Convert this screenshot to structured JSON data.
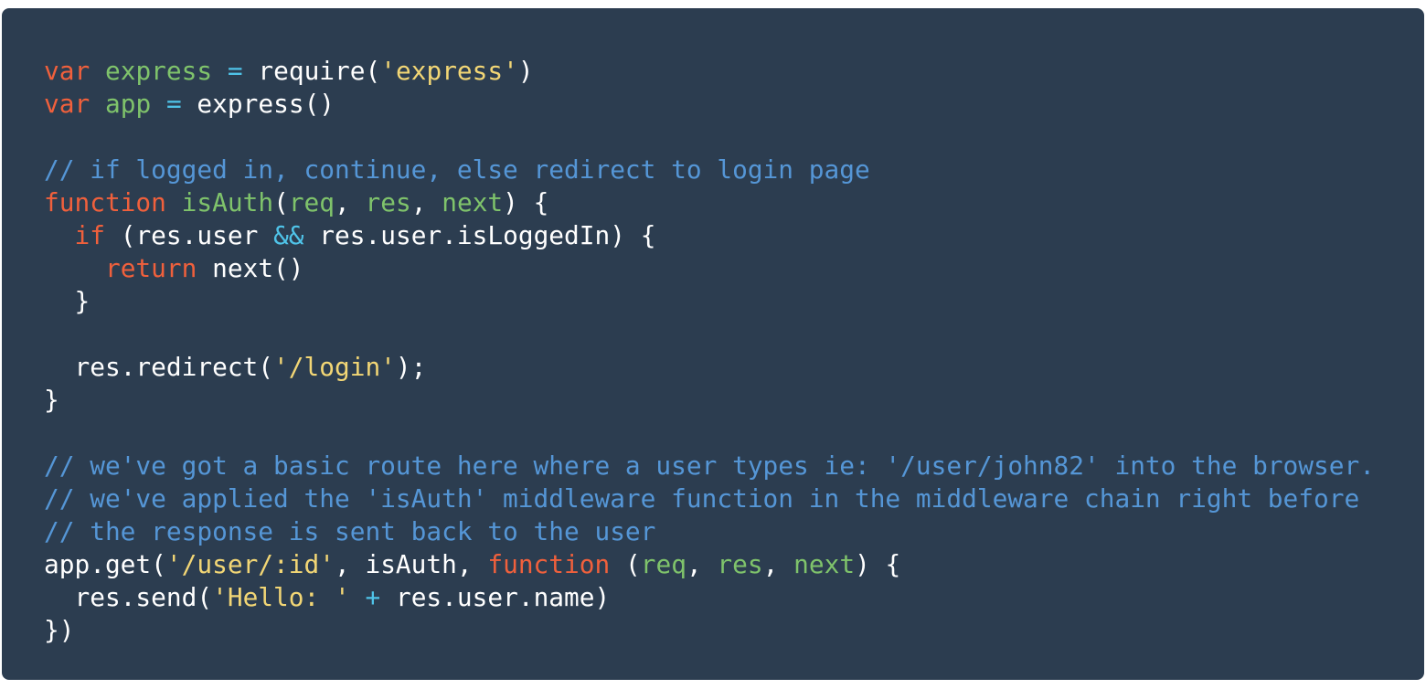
{
  "colors": {
    "background": "#2c3d50",
    "plain": "#ffffff",
    "keyword": "#f0603c",
    "identifier": "#7fc36b",
    "string": "#f2d675",
    "comment": "#5596d6",
    "operator": "#4fc3e8"
  },
  "code_lines": [
    [
      [
        "keyword",
        "var"
      ],
      [
        "plain",
        " "
      ],
      [
        "identifier",
        "express"
      ],
      [
        "plain",
        " "
      ],
      [
        "operator",
        "="
      ],
      [
        "plain",
        " require("
      ],
      [
        "string",
        "'express'"
      ],
      [
        "plain",
        ")"
      ]
    ],
    [
      [
        "keyword",
        "var"
      ],
      [
        "plain",
        " "
      ],
      [
        "identifier",
        "app"
      ],
      [
        "plain",
        " "
      ],
      [
        "operator",
        "="
      ],
      [
        "plain",
        " express()"
      ]
    ],
    [],
    [
      [
        "comment",
        "// if logged in, continue, else redirect to login page"
      ]
    ],
    [
      [
        "keyword",
        "function"
      ],
      [
        "plain",
        " "
      ],
      [
        "identifier",
        "isAuth"
      ],
      [
        "plain",
        "("
      ],
      [
        "identifier",
        "req"
      ],
      [
        "plain",
        ", "
      ],
      [
        "identifier",
        "res"
      ],
      [
        "plain",
        ", "
      ],
      [
        "identifier",
        "next"
      ],
      [
        "plain",
        ") {"
      ]
    ],
    [
      [
        "plain",
        "  "
      ],
      [
        "keyword",
        "if"
      ],
      [
        "plain",
        " (res.user "
      ],
      [
        "operator",
        "&&"
      ],
      [
        "plain",
        " res.user.isLoggedIn) {"
      ]
    ],
    [
      [
        "plain",
        "    "
      ],
      [
        "keyword",
        "return"
      ],
      [
        "plain",
        " next()"
      ]
    ],
    [
      [
        "plain",
        "  }"
      ]
    ],
    [],
    [
      [
        "plain",
        "  res.redirect("
      ],
      [
        "string",
        "'/login'"
      ],
      [
        "plain",
        ");"
      ]
    ],
    [
      [
        "plain",
        "}"
      ]
    ],
    [],
    [
      [
        "comment",
        "// we've got a basic route here where a user types ie: '/user/john82' into the browser."
      ]
    ],
    [
      [
        "comment",
        "// we've applied the 'isAuth' middleware function in the middleware chain right before"
      ]
    ],
    [
      [
        "comment",
        "// the response is sent back to the user"
      ]
    ],
    [
      [
        "plain",
        "app.get("
      ],
      [
        "string",
        "'/user/:id'"
      ],
      [
        "plain",
        ", isAuth, "
      ],
      [
        "keyword",
        "function"
      ],
      [
        "plain",
        " ("
      ],
      [
        "identifier",
        "req"
      ],
      [
        "plain",
        ", "
      ],
      [
        "identifier",
        "res"
      ],
      [
        "plain",
        ", "
      ],
      [
        "identifier",
        "next"
      ],
      [
        "plain",
        ") {"
      ]
    ],
    [
      [
        "plain",
        "  res.send("
      ],
      [
        "string",
        "'Hello: '"
      ],
      [
        "plain",
        " "
      ],
      [
        "operator",
        "+"
      ],
      [
        "plain",
        " res.user.name)"
      ]
    ],
    [
      [
        "plain",
        "})"
      ]
    ]
  ]
}
